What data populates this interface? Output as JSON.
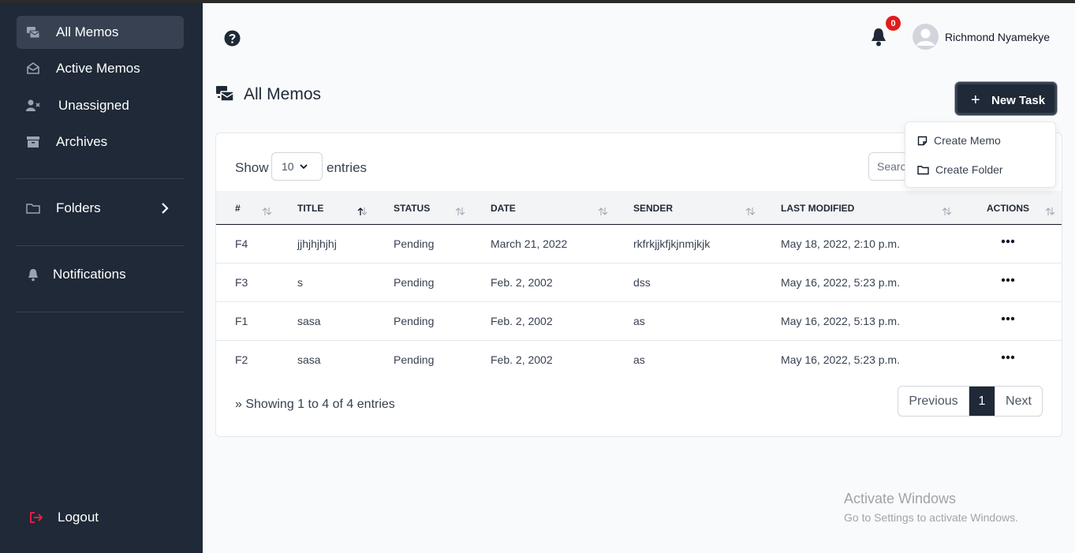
{
  "sidebar": {
    "items": [
      {
        "label": "All Memos",
        "icon": "memos-icon"
      },
      {
        "label": "Active Memos",
        "icon": "envelope-open-icon"
      },
      {
        "label": "Unassigned",
        "icon": "user-x-icon"
      },
      {
        "label": "Archives",
        "icon": "archive-icon"
      }
    ],
    "folders_label": "Folders",
    "notifications_label": "Notifications",
    "logout_label": "Logout"
  },
  "header": {
    "notification_count": "0",
    "username": "Richmond Nyamekye"
  },
  "page": {
    "title": "All Memos",
    "new_task_label": "New Task"
  },
  "dropdown": {
    "items": [
      {
        "label": "Create Memo"
      },
      {
        "label": "Create Folder"
      }
    ]
  },
  "table": {
    "show_label": "Show",
    "entries_label": "entries",
    "page_length": "10",
    "search_placeholder": "Search:",
    "columns": [
      "#",
      "TITLE",
      "STATUS",
      "DATE",
      "SENDER",
      "LAST MODIFIED",
      "ACTIONS"
    ],
    "rows": [
      {
        "id": "F4",
        "title": "jjhjhjhjhj",
        "status": "Pending",
        "date": "March 21, 2022",
        "sender": "rkfrkjjkfjkjnmjkjk",
        "modified": "May 18, 2022, 2:10 p.m."
      },
      {
        "id": "F3",
        "title": "s",
        "status": "Pending",
        "date": "Feb. 2, 2002",
        "sender": "dss",
        "modified": "May 16, 2022, 5:23 p.m."
      },
      {
        "id": "F1",
        "title": "sasa",
        "status": "Pending",
        "date": "Feb. 2, 2002",
        "sender": "as",
        "modified": "May 16, 2022, 5:13 p.m."
      },
      {
        "id": "F2",
        "title": "sasa",
        "status": "Pending",
        "date": "Feb. 2, 2002",
        "sender": "as",
        "modified": "May 16, 2022, 5:23 p.m."
      }
    ],
    "info": "» Showing 1 to 4 of 4 entries",
    "pagination": {
      "previous": "Previous",
      "current": "1",
      "next": "Next"
    }
  },
  "watermark": {
    "line1": "Activate Windows",
    "line2": "Go to Settings to activate Windows."
  },
  "colors": {
    "sidebar_bg": "#1f2937",
    "accent": "#1f2937",
    "badge": "#e11d1d",
    "logout_icon": "#e11d48"
  }
}
